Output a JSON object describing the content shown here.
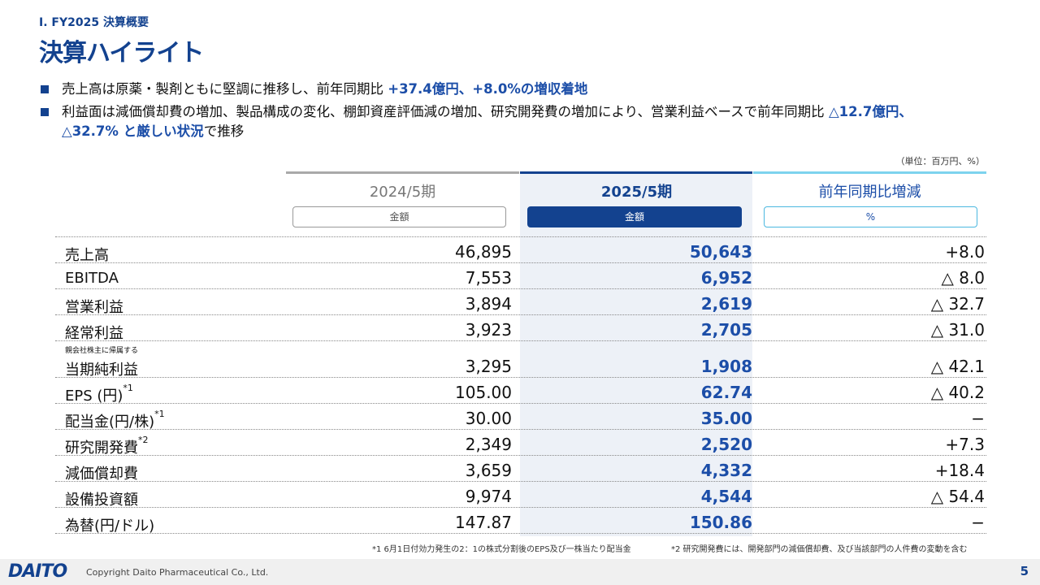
{
  "header": {
    "section": "Ⅰ. FY2025 決算概要",
    "title": "決算ハイライト"
  },
  "bullets": [
    {
      "pre": "売上高は原薬・製剤ともに堅調に推移し、前年同期比 ",
      "em": "+37.4億円、+8.0%の増収着地",
      "post": ""
    },
    {
      "pre": "利益面は減価償却費の増加、製品構成の変化、棚卸資産評価減の増加、研究開発費の増加により、営業利益ベースで前年同期比 ",
      "em": "△12.7億円、",
      "pre2": "",
      "em2": "△32.7% と厳しい状況",
      "post": "で推移"
    }
  ],
  "unit": "（単位：百万円、%）",
  "columns": {
    "prev": {
      "label": "2024/5期",
      "sub": "金額"
    },
    "curr": {
      "label": "2025/5期",
      "sub": "金額"
    },
    "chg": {
      "label": "前年同期比増減",
      "sub": "%"
    }
  },
  "colors": {
    "navy": "#13428f",
    "accent_blue": "#1c4ea8",
    "light_cyan": "#7dd3ee",
    "gray_bar": "#a9a9a9",
    "col_bg": "#edf1f7"
  },
  "table": {
    "rows": [
      {
        "label": "売上高",
        "sup": "",
        "small": "",
        "prev": "46,895",
        "curr": "50,643",
        "chg": "+8.0"
      },
      {
        "label": "EBITDA",
        "sup": "",
        "small": "",
        "prev": "7,553",
        "curr": "6,952",
        "chg": "△ 8.0"
      },
      {
        "label": "営業利益",
        "sup": "",
        "small": "",
        "prev": "3,894",
        "curr": "2,619",
        "chg": "△ 32.7"
      },
      {
        "label": "経常利益",
        "sup": "",
        "small": "",
        "prev": "3,923",
        "curr": "2,705",
        "chg": "△ 31.0"
      },
      {
        "label": "当期純利益",
        "sup": "",
        "small": "親会社株主に帰属する",
        "prev": "3,295",
        "curr": "1,908",
        "chg": "△ 42.1"
      },
      {
        "label": "EPS (円)",
        "sup": "*1",
        "small": "",
        "prev": "105.00",
        "curr": "62.74",
        "chg": "△ 40.2"
      },
      {
        "label": "配当金(円/株)",
        "sup": "*1",
        "small": "",
        "prev": "30.00",
        "curr": "35.00",
        "chg": "−"
      },
      {
        "label": "研究開発費",
        "sup": "*2",
        "small": "",
        "prev": "2,349",
        "curr": "2,520",
        "chg": "+7.3"
      },
      {
        "label": "減価償却費",
        "sup": "",
        "small": "",
        "prev": "3,659",
        "curr": "4,332",
        "chg": "+18.4"
      },
      {
        "label": "設備投資額",
        "sup": "",
        "small": "",
        "prev": "9,974",
        "curr": "4,544",
        "chg": "△ 54.4"
      },
      {
        "label": "為替(円/ドル)",
        "sup": "",
        "small": "",
        "prev": "147.87",
        "curr": "150.86",
        "chg": "−"
      }
    ]
  },
  "footnotes": {
    "n1": "*1 6月1日付効力発生の2：1の株式分割後のEPS及び一株当たり配当金",
    "n2": "*2 研究開発費には、開発部門の減価償却費、及び当該部門の人件費の変動を含む"
  },
  "footer": {
    "logo": "DAITO",
    "copyright": "Copyright  Daito Pharmaceutical Co., Ltd.",
    "page": "5"
  }
}
